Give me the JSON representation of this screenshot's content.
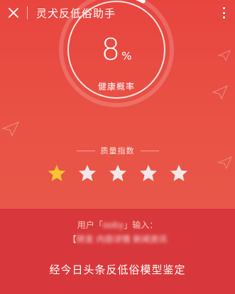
{
  "header": {
    "close_icon": "close-icon",
    "title": "灵犬反低俗助手",
    "more_icon": "more-vertical-icon"
  },
  "gauge": {
    "percent_value": "8",
    "percent_sign": "%",
    "label": "健康概率",
    "fill_fraction": 0.08
  },
  "quality": {
    "label": "质量指数",
    "rating": 1,
    "max": 5,
    "filled_color": "#f7c531",
    "empty_color": "#f1e9e9"
  },
  "result": {
    "user_prefix": "用户「",
    "user_name": "ooby",
    "user_suffix": "」输入：",
    "input_open": "【",
    "input_text": "转发 内容详情 新闻资讯",
    "input_close": "",
    "verdict": "经今日头条反低俗模型鉴定"
  },
  "colors": {
    "background": "#e8453f",
    "band": "#d8383b",
    "star_gold": "#f7c531"
  }
}
